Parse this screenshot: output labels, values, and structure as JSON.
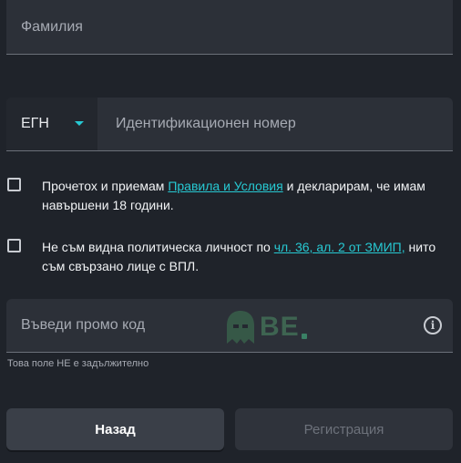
{
  "surname": {
    "placeholder": "Фамилия"
  },
  "egn": {
    "type_value": "ЕГН",
    "placeholder": "Идентификационен номер"
  },
  "terms": {
    "text_before": "Прочетох и приемам ",
    "link_text": "Правила и Условия",
    "text_after": " и декларирам, че имам навършени 18 години.",
    "checked": false
  },
  "pep": {
    "text_before": "Не съм видна политическа личност по ",
    "link_text": "чл. 36, ал. 2 от ЗМИП,",
    "text_after": " нито съм свързано лице с ВПЛ.",
    "checked": false
  },
  "promo": {
    "placeholder": "Въведи промо код",
    "helper": "Това поле НЕ е задължително",
    "info_icon": "info-icon"
  },
  "watermark": {
    "text": "BE"
  },
  "buttons": {
    "back_label": "Назад",
    "register_label": "Регистрация"
  },
  "colors": {
    "accent": "#27c9d3",
    "background": "#1f232a",
    "field": "#2c3038"
  }
}
